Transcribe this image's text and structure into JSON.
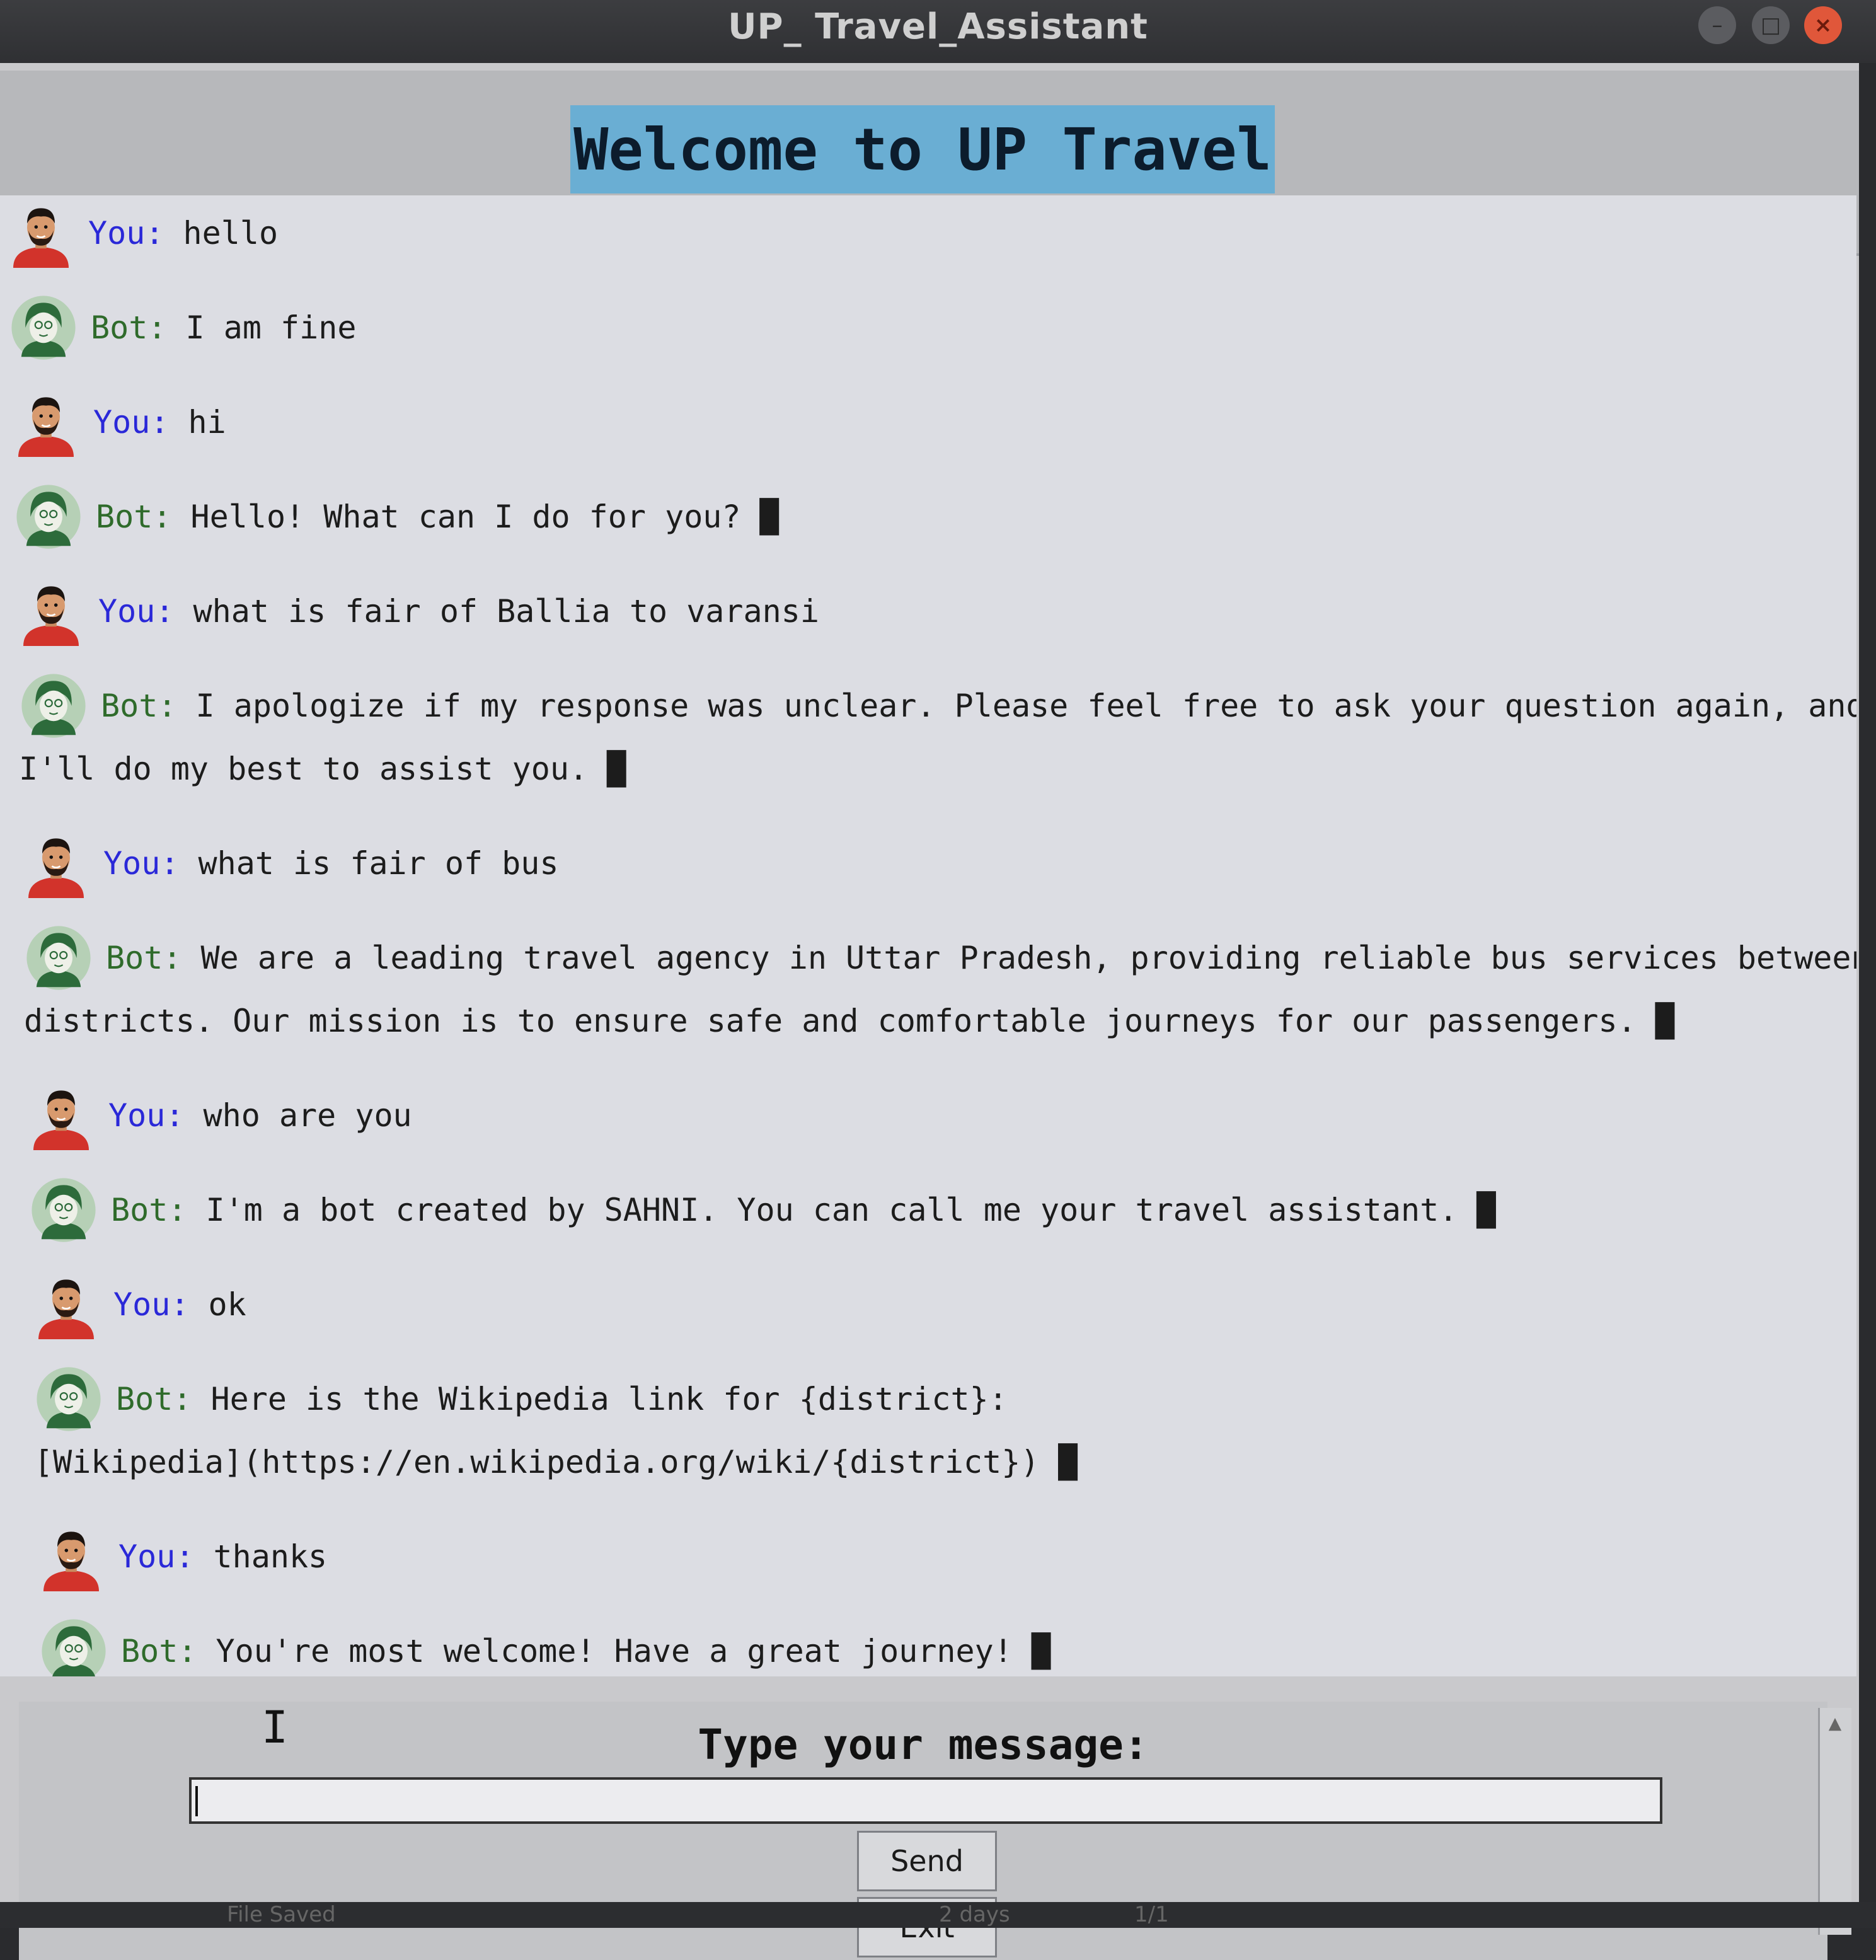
{
  "window": {
    "title": "UP_ Travel_Assistant"
  },
  "header": {
    "banner": "Welcome to UP Travel"
  },
  "messages": [
    {
      "sender": "You:",
      "lines": [
        "hello"
      ]
    },
    {
      "sender": "Bot:",
      "lines": [
        "I am fine"
      ]
    },
    {
      "sender": "You:",
      "lines": [
        "hi"
      ]
    },
    {
      "sender": "Bot:",
      "lines": [
        "Hello! What can I do for you? █"
      ]
    },
    {
      "sender": "You:",
      "lines": [
        "what is fair of Ballia to varansi"
      ]
    },
    {
      "sender": "Bot:",
      "lines": [
        "I apologize if my response was unclear. Please feel free to ask your question again, and",
        "I'll do my best to assist you. █"
      ]
    },
    {
      "sender": "You:",
      "lines": [
        "what is fair of bus"
      ]
    },
    {
      "sender": "Bot:",
      "lines": [
        "We are a leading travel agency in Uttar Pradesh, providing reliable bus services between",
        "districts. Our mission is to ensure safe and comfortable journeys for our passengers. █"
      ]
    },
    {
      "sender": "You:",
      "lines": [
        "who are you"
      ]
    },
    {
      "sender": "Bot:",
      "lines": [
        "I'm a bot created by SAHNI. You can call me your travel assistant. █"
      ]
    },
    {
      "sender": "You:",
      "lines": [
        "ok"
      ]
    },
    {
      "sender": "Bot:",
      "lines": [
        "Here is the Wikipedia link for {district}:",
        "[Wikipedia](https://en.wikipedia.org/wiki/{district}) █"
      ]
    },
    {
      "sender": "You:",
      "lines": [
        "thanks"
      ]
    },
    {
      "sender": "Bot:",
      "lines": [
        "You're most welcome! Have a great journey! █"
      ]
    }
  ],
  "input": {
    "prompt": "Type your message:",
    "value": ""
  },
  "buttons": {
    "send": "Send",
    "exit": "Exit"
  },
  "status": {
    "left": "File Saved",
    "middle": "2 days",
    "page": "1/1"
  },
  "colors": {
    "user_label": "#2a28d8",
    "bot_label": "#2f6b2b",
    "banner_bg": "#6aaed3"
  }
}
